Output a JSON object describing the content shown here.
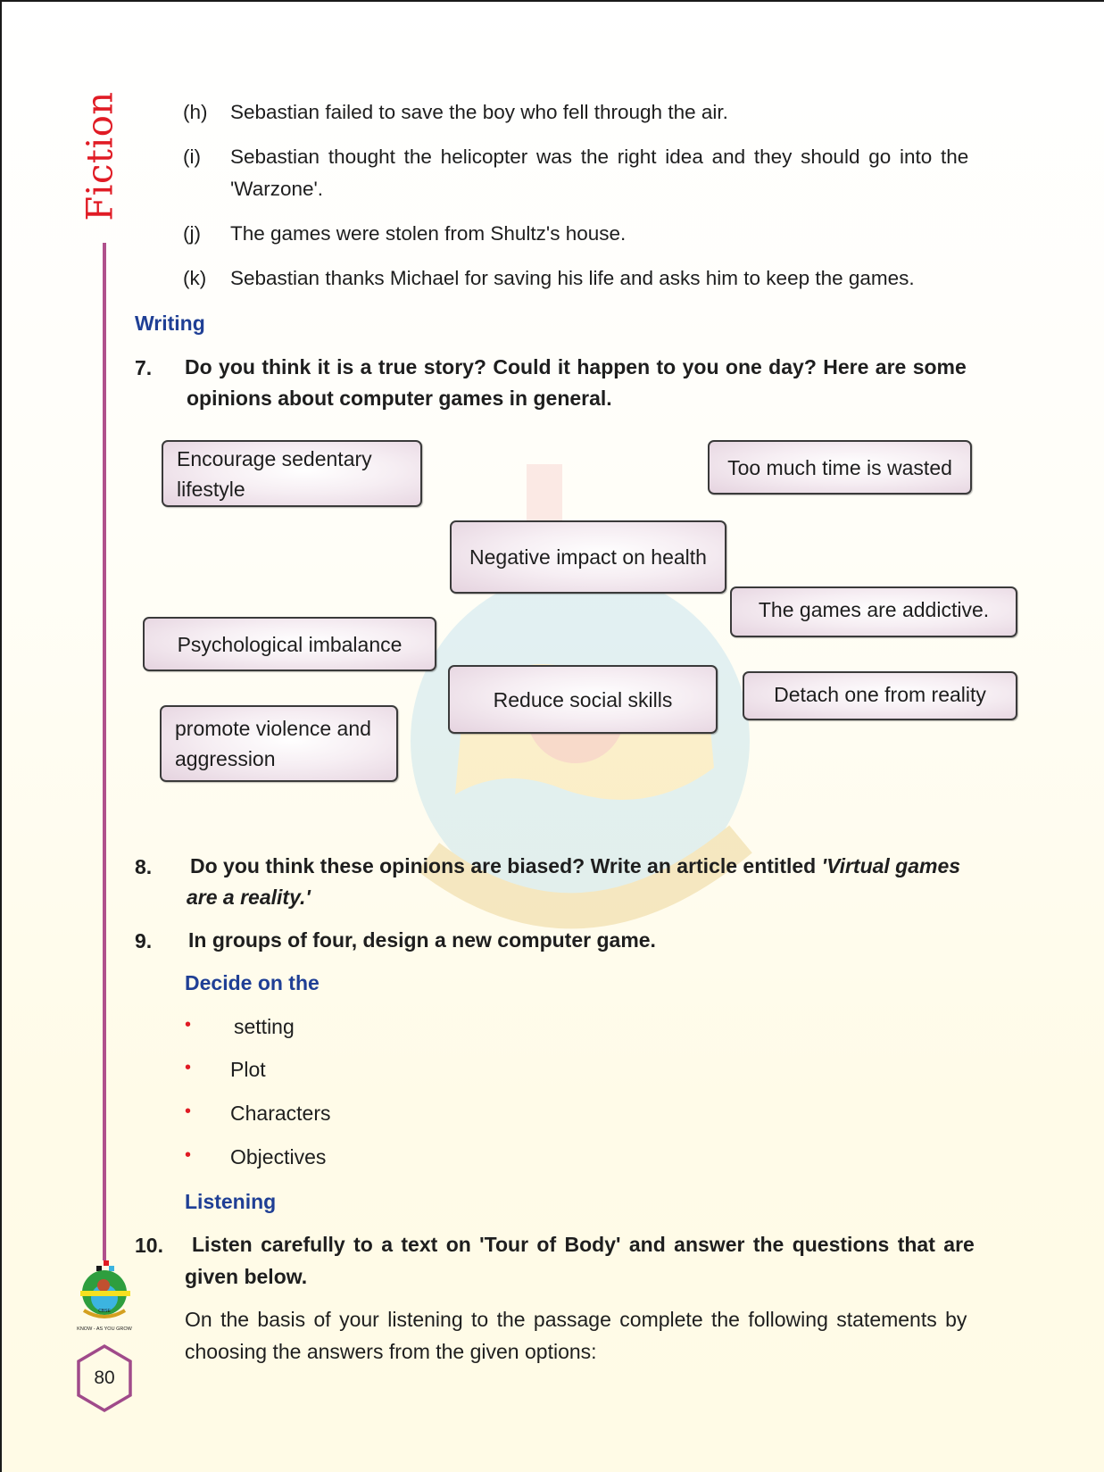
{
  "side_title": "Fiction",
  "comprehension_items": [
    {
      "label": "(h)",
      "text": "Sebastian failed to save the boy who fell through the air."
    },
    {
      "label": "(i)",
      "text": "Sebastian thought the helicopter was the right idea and they should go into the",
      "text_line2": "'Warzone'."
    },
    {
      "label": "(j)",
      "text": "The games were stolen from Shultz's house."
    },
    {
      "label": "(k)",
      "text": "Sebastian thanks Michael for saving his life and asks him to keep the games."
    }
  ],
  "writing_heading": "Writing",
  "q7": {
    "number": "7.",
    "line1": "Do you think it is a true story? Could it happen to you one day?  Here are some",
    "line2": "opinions about computer games in general."
  },
  "opinions": [
    {
      "line1": "Encourage sedentary",
      "line2": "lifestyle"
    },
    {
      "line1": "Too much time is wasted"
    },
    {
      "line1": "Negative impact on health"
    },
    {
      "line1": "The games are addictive."
    },
    {
      "line1": "Psychological imbalance"
    },
    {
      "line1": "Reduce social skills"
    },
    {
      "line1": "Detach one from reality"
    },
    {
      "line1": "promote violence and",
      "line2": "aggression"
    }
  ],
  "q8": {
    "number": "8.",
    "line1_plain": "Do you think these opinions are biased? Write an article entitled ",
    "line1_italic": "'Virtual games",
    "line2_italic": "are a reality.'"
  },
  "q9": {
    "number": "9.",
    "text": "In groups of four, design a new computer game."
  },
  "decide_heading": "Decide on the",
  "decide_items": [
    "setting",
    "Plot",
    "Characters",
    "Objectives"
  ],
  "listening_heading": "Listening",
  "q10": {
    "number": "10.",
    "line1": "Listen carefully to a text on 'Tour of Body' and answer the questions that are",
    "line2": "given below."
  },
  "instruction": {
    "line1": "On the basis of your listening to the passage complete the following statements by",
    "line2": "choosing the answers from the given options:"
  },
  "logo_caption": "KNOW - AS YOU GROW",
  "page_number": "80",
  "colors": {
    "side_title": "#e01b24",
    "side_line": "#b0508c",
    "heading_blue": "#1f3f95",
    "bullet_red": "#e01b24"
  }
}
